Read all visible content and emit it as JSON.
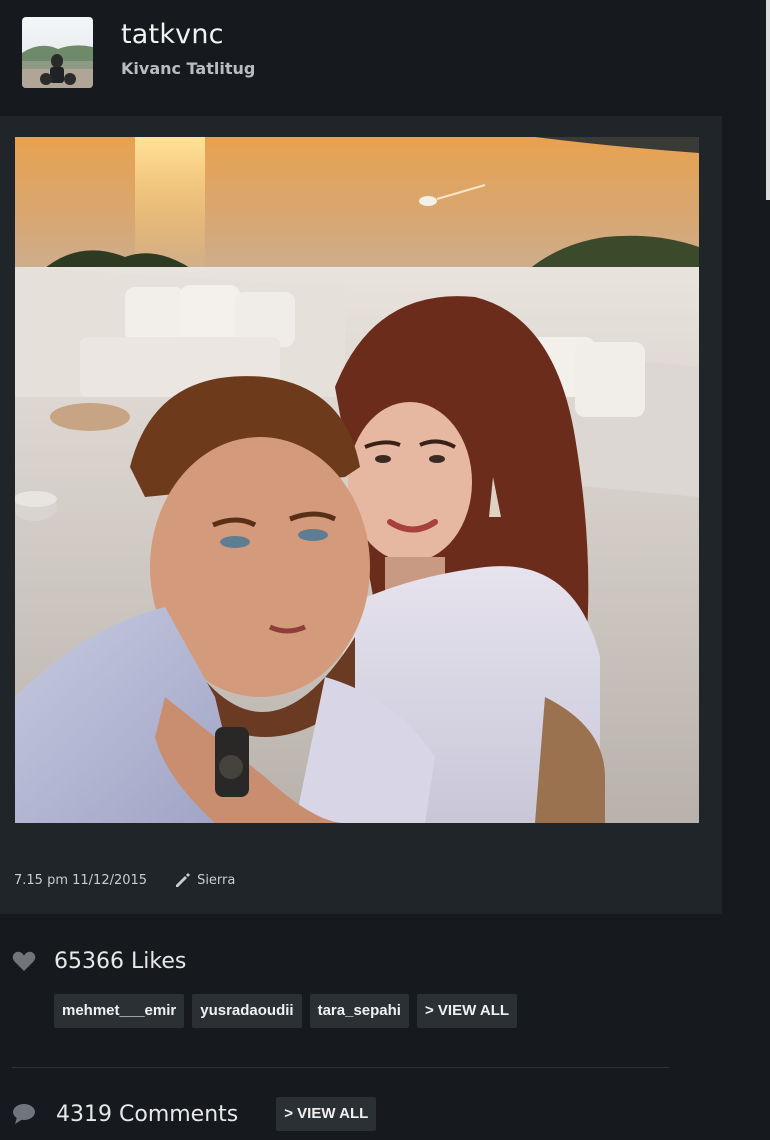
{
  "profile": {
    "username": "tatkvnc",
    "full_name": "Kivanc Tatlitug",
    "avatar_icon": "avatar-photo"
  },
  "post": {
    "photo_description_icon": "couple-selfie-photo",
    "time": "7.15 pm 11/12/2015",
    "filter_icon": "pencil-icon",
    "filter_name": "Sierra"
  },
  "likes": {
    "count": "65366",
    "label": "Likes",
    "likers": [
      "mehmet___emir",
      "yusradaoudii",
      "tara_sepahi"
    ],
    "view_all_label": "> VIEW ALL"
  },
  "comments": {
    "count": "4319",
    "label": "Comments",
    "view_all_label": "> VIEW ALL"
  },
  "colors": {
    "background": "#161a1e",
    "card": "#20252a",
    "tag_background": "#2b3035",
    "icon_gray": "#6f757b"
  }
}
